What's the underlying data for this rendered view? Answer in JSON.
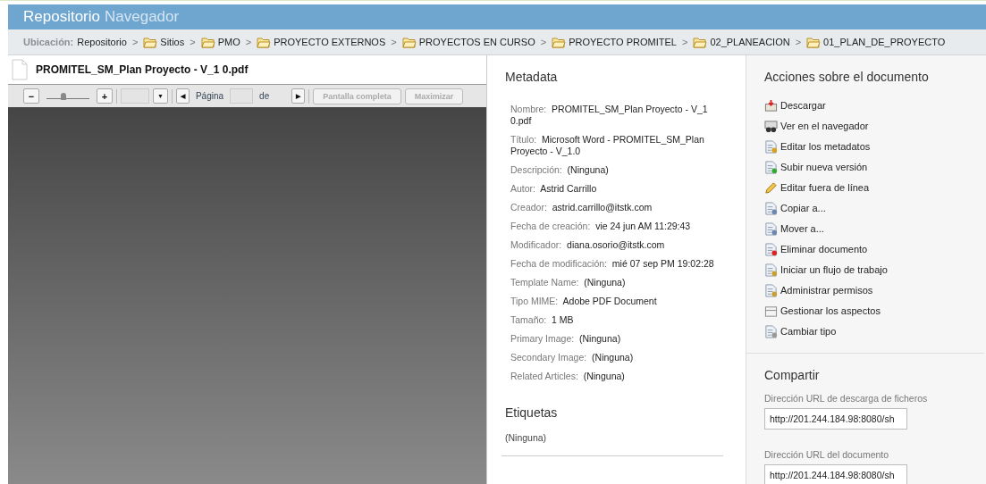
{
  "header": {
    "title": "Repositorio",
    "subtitle": "Navegador"
  },
  "breadcrumb": {
    "label": "Ubicación:",
    "items": [
      {
        "label": "Repositorio",
        "folder": false
      },
      {
        "label": "Sitios",
        "folder": true
      },
      {
        "label": "PMO",
        "folder": true
      },
      {
        "label": "PROYECTO EXTERNOS",
        "folder": true
      },
      {
        "label": "PROYECTOS EN CURSO",
        "folder": true
      },
      {
        "label": "PROYECTO PROMITEL",
        "folder": true
      },
      {
        "label": "02_PLANEACION",
        "folder": true
      },
      {
        "label": "01_PLAN_DE_PROYECTO",
        "folder": true
      }
    ],
    "separator": ">"
  },
  "viewer": {
    "filename": "PROMITEL_SM_Plan Proyecto - V_1 0.pdf",
    "zoom_out": "−",
    "zoom_in": "+",
    "zoom": {
      "level": 0.4
    },
    "prev": "◀",
    "page_label": "Página",
    "of_label": "de",
    "next": "▶",
    "dropdown": "▼",
    "buttons": [
      {
        "label": "Pantalla completa",
        "disabled": true
      },
      {
        "label": "Maximizar",
        "disabled": true
      }
    ]
  },
  "metadata": {
    "title": "Metadata",
    "fields": [
      {
        "label": "Nombre:",
        "value": "PROMITEL_SM_Plan Proyecto - V_1 0.pdf"
      },
      {
        "label": "Título:",
        "value": "Microsoft Word - PROMITEL_SM_Plan Proyecto - V_1.0"
      },
      {
        "label": "Descripción:",
        "value": "(Ninguna)"
      },
      {
        "label": "Autor:",
        "value": "Astrid Carrillo"
      },
      {
        "label": "Creador:",
        "value": "astrid.carrillo@itstk.com"
      },
      {
        "label": "Fecha de creación:",
        "value": "vie 24 jun AM 11:29:43"
      },
      {
        "label": "Modificador:",
        "value": "diana.osorio@itstk.com"
      },
      {
        "label": "Fecha de modificación:",
        "value": "mié 07 sep PM 19:02:28"
      },
      {
        "label": "Template Name:",
        "value": "(Ninguna)"
      },
      {
        "label": "Tipo MIME:",
        "value": "Adobe PDF Document"
      },
      {
        "label": "Tamaño:",
        "value": "1 MB"
      },
      {
        "label": "Primary Image:",
        "value": "(Ninguna)"
      },
      {
        "label": "Secondary Image:",
        "value": "(Ninguna)"
      },
      {
        "label": "Related Articles:",
        "value": "(Ninguna)"
      }
    ],
    "tags_title": "Etiquetas",
    "tags": "(Ninguna)"
  },
  "actions": {
    "title": "Acciones sobre el documento",
    "items": [
      {
        "label": "Descargar",
        "kind": "download"
      },
      {
        "label": "Ver en el navegador",
        "kind": "view"
      },
      {
        "label": "Editar los metadatos",
        "kind": "edit"
      },
      {
        "label": "Subir nueva versión",
        "kind": "upload"
      },
      {
        "label": "Editar fuera de línea",
        "kind": "pencil"
      },
      {
        "label": "Copiar a...",
        "kind": "copy"
      },
      {
        "label": "Mover a...",
        "kind": "move"
      },
      {
        "label": "Eliminar documento",
        "kind": "delete"
      },
      {
        "label": "Iniciar un flujo de trabajo",
        "kind": "workflow"
      },
      {
        "label": "Administrar permisos",
        "kind": "permissions"
      },
      {
        "label": "Gestionar los aspectos",
        "kind": "aspects"
      },
      {
        "label": "Cambiar tipo",
        "kind": "type"
      }
    ]
  },
  "share": {
    "title": "Compartir",
    "fields": [
      {
        "label": "Dirección URL de descarga de ficheros",
        "value": "http://201.244.184.98:8080/sh"
      },
      {
        "label": "Dirección URL del documento",
        "value": "http://201.244.184.98:8080/sh"
      }
    ]
  }
}
